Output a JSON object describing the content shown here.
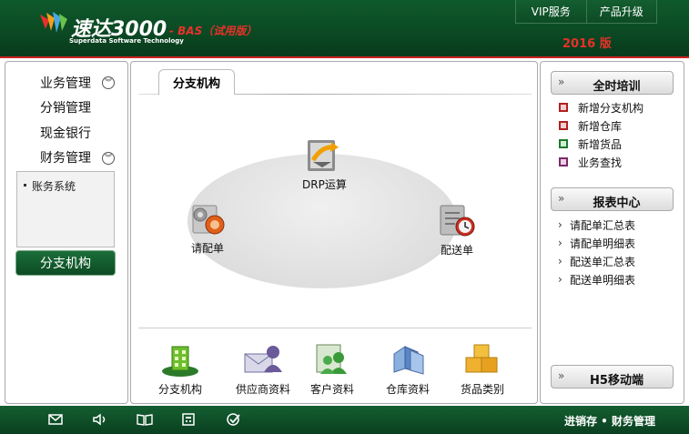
{
  "header": {
    "brand": "速达3000",
    "brand_sub": "Superdata Software Technology",
    "edition": "- BAS（试用版）",
    "year": "2016 版",
    "top_links": [
      "VIP服务",
      "产品升级"
    ]
  },
  "sidebar": {
    "items": [
      {
        "label": "业务管理",
        "expandable": true
      },
      {
        "label": "分销管理",
        "expandable": false
      },
      {
        "label": "现金银行",
        "expandable": false
      },
      {
        "label": "财务管理",
        "expandable": true
      }
    ],
    "sub_items": [
      "账务系统"
    ],
    "active_button": "分支机构"
  },
  "main": {
    "tab": "分支机构",
    "nodes": [
      {
        "label": "DRP运算",
        "icon": "drp-calc-icon"
      },
      {
        "label": "请配单",
        "icon": "gear-order-icon"
      },
      {
        "label": "配送单",
        "icon": "delivery-clock-icon"
      }
    ],
    "quick_access": [
      {
        "label": "分支机构",
        "icon": "branch-building-icon"
      },
      {
        "label": "供应商资料",
        "icon": "supplier-icon"
      },
      {
        "label": "客户资料",
        "icon": "customer-icon"
      },
      {
        "label": "仓库资料",
        "icon": "warehouse-icon"
      },
      {
        "label": "货品类别",
        "icon": "goods-boxes-icon"
      }
    ]
  },
  "right": {
    "training": {
      "title": "全时培训",
      "links": [
        {
          "label": "新增分支机构",
          "color": "#b02020"
        },
        {
          "label": "新增仓库",
          "color": "#b02020"
        },
        {
          "label": "新增货品",
          "color": "#1d7a2e"
        },
        {
          "label": "业务查找",
          "color": "#7a2a6a"
        }
      ]
    },
    "reports": {
      "title": "报表中心",
      "links": [
        "请配单汇总表",
        "请配单明细表",
        "配送单汇总表",
        "配送单明细表"
      ]
    },
    "mobile": {
      "title": "H5移动端"
    }
  },
  "footer": {
    "icons": [
      "mail-icon",
      "speaker-icon",
      "book-icon",
      "calculator-icon",
      "check-circle-icon"
    ],
    "text": "进销存 • 财务管理"
  },
  "colors": {
    "header_green": "#0c4a24",
    "accent_red": "#e8312a",
    "button_green": "#1b6e39"
  }
}
